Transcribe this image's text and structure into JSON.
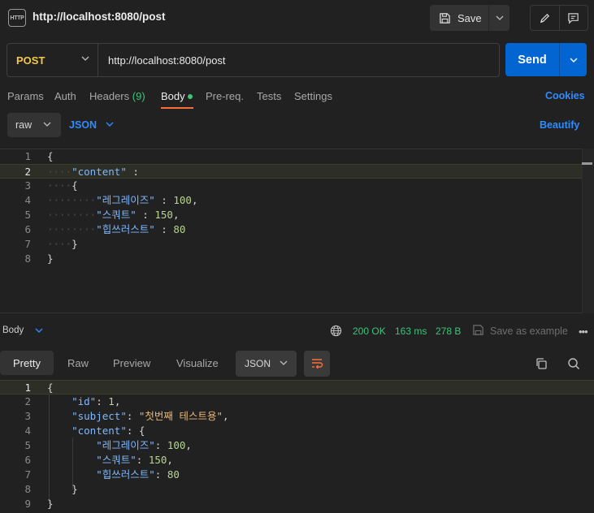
{
  "topbar": {
    "app_icon_text": "HTTP",
    "tab_title": "http://localhost:8080/post",
    "save_label": "Save"
  },
  "request": {
    "method": "POST",
    "url": "http://localhost:8080/post",
    "send_label": "Send",
    "tabs": [
      {
        "label": "Params"
      },
      {
        "label": "Auth"
      },
      {
        "label": "Headers",
        "count": "(9)"
      },
      {
        "label": "Body",
        "active": true
      },
      {
        "label": "Pre-req."
      },
      {
        "label": "Tests"
      },
      {
        "label": "Settings"
      }
    ],
    "cookies_label": "Cookies",
    "body_mode": "raw",
    "body_format": "JSON",
    "beautify_label": "Beautify",
    "line_numbers": [
      "1",
      "2",
      "3",
      "4",
      "5",
      "6",
      "7",
      "8"
    ],
    "active_line": 2,
    "code": {
      "l1": "{",
      "l2_key": "\"content\"",
      "l2_colon": " :",
      "l3": "{",
      "l4_key": "\"레그레이즈\"",
      "l4_val": "100",
      "l5_key": "\"스쿼트\"",
      "l5_val": "150",
      "l6_key": "\"힙쓰러스트\"",
      "l6_val": "80",
      "l7": "}",
      "l8": "}"
    }
  },
  "response": {
    "section_label": "Body",
    "status": "200 OK",
    "time": "163 ms",
    "size": "278 B",
    "save_example_label": "Save as example",
    "more_label": "•••",
    "tabs": {
      "pretty": "Pretty",
      "raw": "Raw",
      "preview": "Preview",
      "visualize": "Visualize"
    },
    "format": "JSON",
    "line_numbers": [
      "1",
      "2",
      "3",
      "4",
      "5",
      "6",
      "7",
      "8",
      "9"
    ],
    "active_line": 1,
    "code": {
      "l1": "{",
      "id_key": "\"id\"",
      "id_val": "1",
      "subject_key": "\"subject\"",
      "subject_val": "\"첫번째 테스트용\"",
      "content_key": "\"content\"",
      "k1": "\"레그레이즈\"",
      "v1": "100",
      "k2": "\"스쿼트\"",
      "v2": "150",
      "k3": "\"힙쓰러스트\"",
      "v3": "80",
      "close_inner": "}",
      "close_outer": "}"
    }
  },
  "colors": {
    "accent_send": "#0265d2",
    "method_post": "#f2c94c",
    "status_green": "#3ec47a",
    "link_blue": "#2d8cff",
    "tab_underline": "#ff6c37"
  }
}
